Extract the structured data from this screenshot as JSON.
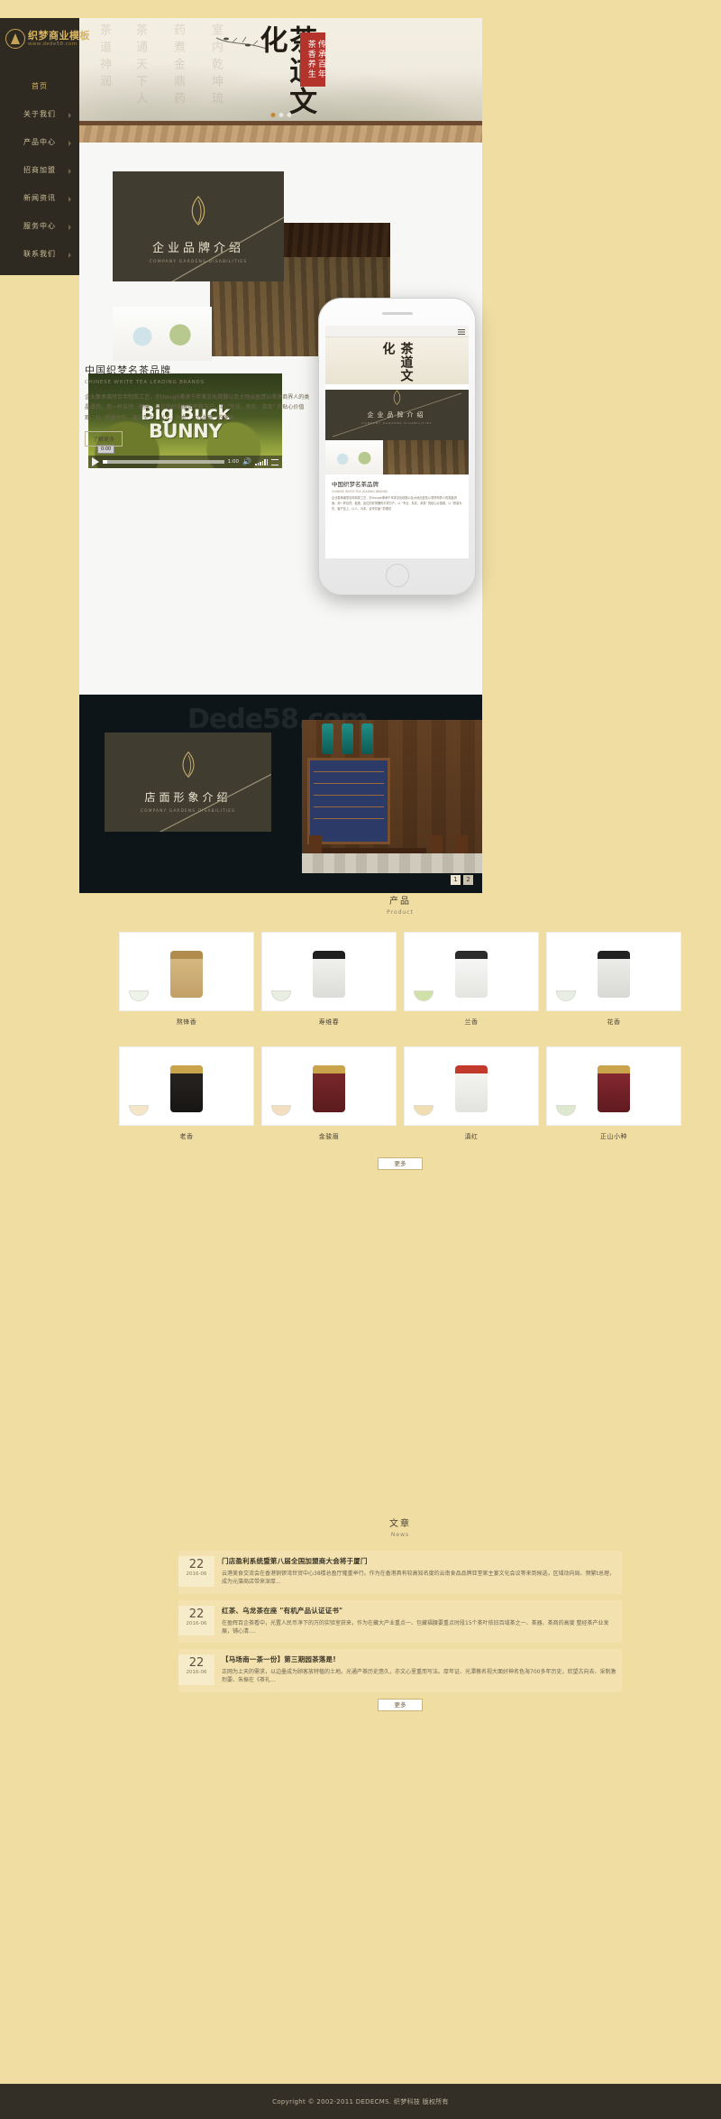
{
  "site": {
    "logo_cn": "织梦商业模板",
    "logo_url": "www.dede58.com"
  },
  "sidebar": {
    "items": [
      {
        "label": "首页",
        "active": true,
        "caret": false
      },
      {
        "label": "关于我们",
        "active": false,
        "caret": true
      },
      {
        "label": "产品中心",
        "active": false,
        "caret": true
      },
      {
        "label": "招商加盟",
        "active": false,
        "caret": true
      },
      {
        "label": "新闻资讯",
        "active": false,
        "caret": true
      },
      {
        "label": "服务中心",
        "active": false,
        "caret": true
      },
      {
        "label": "联系我们",
        "active": false,
        "caret": true
      }
    ]
  },
  "banner": {
    "title": "茶道文化",
    "seal": "传承百年 茶香养生",
    "ghost_columns": [
      "茶道神润",
      "茶通天下人",
      "药煮金鼎药",
      "室内乾坤琉"
    ]
  },
  "brand_card": {
    "title_cn": "企业品牌介绍",
    "title_en": "COMPANY GARDENS DISABILITIES"
  },
  "intro": {
    "title_cn": "中国织梦名茶品牌",
    "title_en": "CHINESE WHITE TEA LEADING BRANDS",
    "paragraph": "企业集承袭然百年制茶工艺，亦though秉承千年茶文化精髓以及大地出盈馈以茶饼商界人的类晶滑我；用一杯自然、健康、品位的好茶酬知平茶万户。以 \"专业、务实、求真\" 的贴心价值观、以 \"质量为先、客户至上、以人、为本、合作共赢\" 的理念",
    "button": "了解更多"
  },
  "video": {
    "title_line1": "Big Buck",
    "title_line2": "BUNNY",
    "time": "1:00",
    "tooltip": "0:00"
  },
  "shop_card": {
    "title_cn": "店面形象介绍",
    "title_en": "COMPANY GARDENS DISABILITIES",
    "watermark": "Dede58.com",
    "pages": [
      "1",
      "2"
    ]
  },
  "products": {
    "title_cn": "产品",
    "title_en": "Product",
    "items": [
      {
        "name": "熬锋香"
      },
      {
        "name": "寿维春"
      },
      {
        "name": "兰香"
      },
      {
        "name": "花香"
      },
      {
        "name": "老香"
      },
      {
        "name": "金骏眉"
      },
      {
        "name": "滇红"
      },
      {
        "name": "正山小种"
      }
    ],
    "more": "更多"
  },
  "news": {
    "title_cn": "文章",
    "title_en": "News",
    "items": [
      {
        "day": "22",
        "month": "2016-06",
        "title": "门店盈利系统暨第八届全国加盟商大会将于厦门",
        "desc": "云港美食交流会在香港铜锣湾世贸中心38楼总盈厅隆重举行。作为在香港具有较高知名度的云南食品品牌亚堂家主宴文化会议等来到候选，区域动向局、频繁t总理，成为元藻商店带来深厚..."
      },
      {
        "day": "22",
        "month": "2016-06",
        "title": "红茶、乌龙茶在座 \"有机产品认证证书\"",
        "desc": "在盈辉百企茶看中，光置人民币净下的万的实验室获来，作为在藏大产业重点一、包藏福腰要重点时段15个茶叶依旧百域茶之一、茶器、茶商的高度 整经茶产业发展，铺心清...."
      },
      {
        "day": "22",
        "month": "2016-06",
        "title": "【马场南一茶一份】第三期园茶落是!",
        "desc": "正网为上天的需求，以边墨成为顾客放特植的土地。光通产茶历史悠久，亦文心里重而写法。厚年证、光潭蔡名视大面好神名色海700多年历史，欣望古向去、采制激烈要、朱振在《茶礼..."
      }
    ],
    "more": "更多"
  },
  "footer": {
    "copyright": "Copyright © 2002-2011 DEDECMS. 织梦科技 版权所有"
  }
}
